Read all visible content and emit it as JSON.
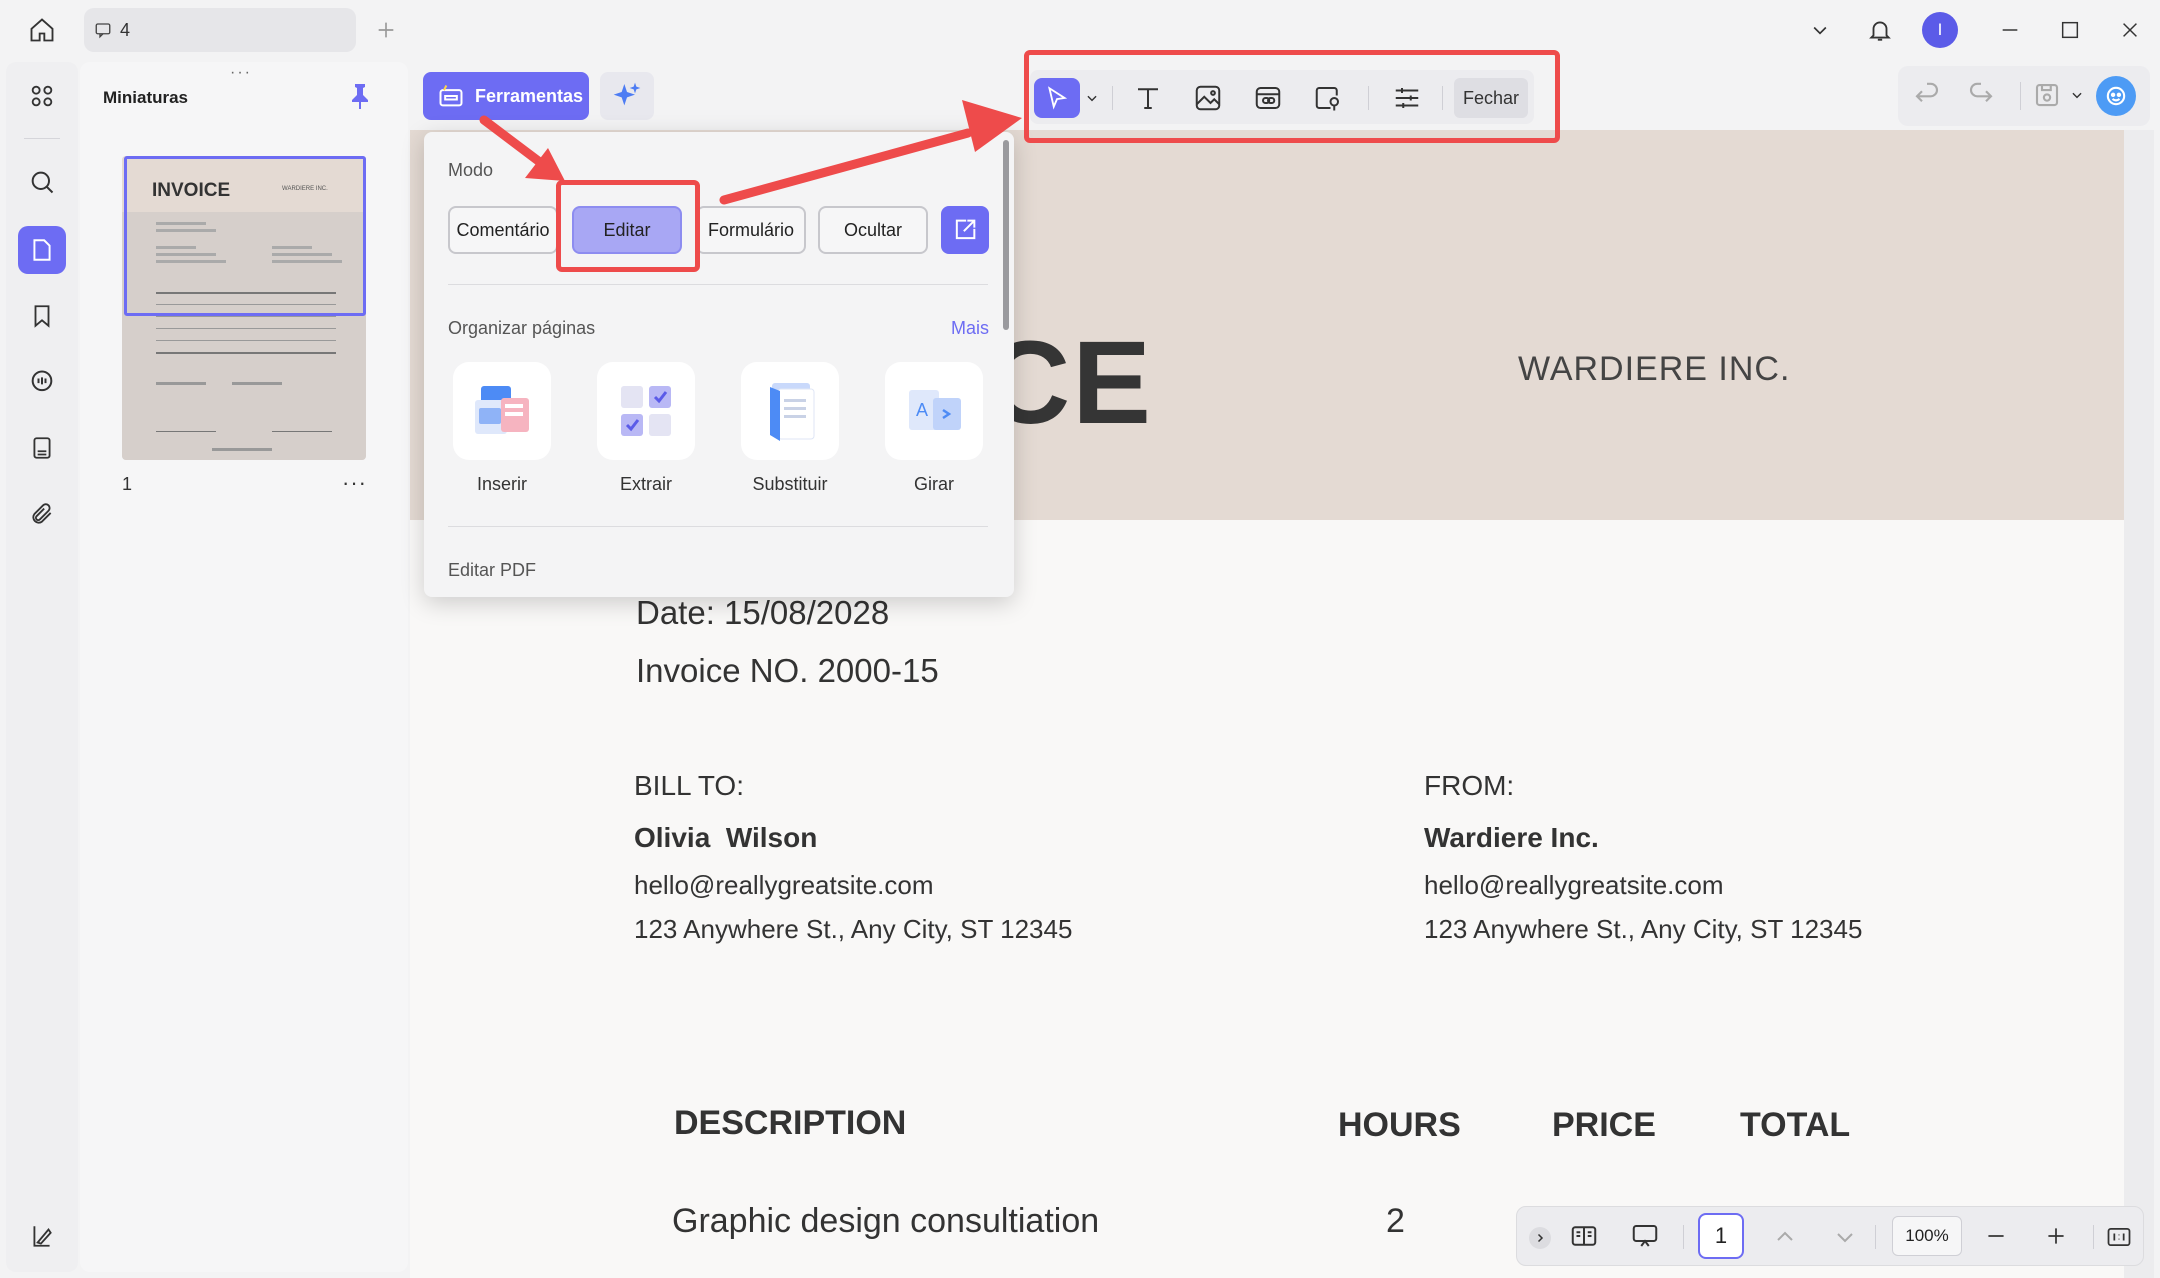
{
  "titlebar": {
    "tab_count": "4"
  },
  "avatar": {
    "initial": "I"
  },
  "thumbnails": {
    "title": "Miniaturas",
    "page_number": "1",
    "more": "···",
    "preview": {
      "title": "INVOICE",
      "company": "WARDIERE INC."
    }
  },
  "toolbar": {
    "tools_label": "Ferramentas",
    "close_label": "Fechar"
  },
  "panel": {
    "mode_heading": "Modo",
    "modes": [
      "Comentário",
      "Editar",
      "Formulário",
      "Ocultar"
    ],
    "organize_heading": "Organizar páginas",
    "more_link": "Mais",
    "organize_items": [
      "Inserir",
      "Extrair",
      "Substituir",
      "Girar"
    ],
    "edit_pdf_heading": "Editar PDF"
  },
  "document": {
    "title_fragment": "CE",
    "company": "WARDIERE INC.",
    "date": "Date: 15/08/2028",
    "invoice_no": "Invoice NO. 2000-15",
    "bill_to": {
      "label": "BILL TO:",
      "name": "Olivia  Wilson",
      "email": "hello@reallygreatsite.com",
      "address": "123 Anywhere St., Any City, ST 12345"
    },
    "from": {
      "label": "FROM:",
      "name": "Wardiere Inc.",
      "email": "hello@reallygreatsite.com",
      "address": "123 Anywhere St., Any City, ST 12345"
    },
    "table": {
      "headers": [
        "DESCRIPTION",
        "HOURS",
        "PRICE",
        "TOTAL"
      ],
      "rows": [
        [
          "Graphic design consultiation",
          "2",
          "",
          ""
        ]
      ]
    }
  },
  "statusbar": {
    "page": "1",
    "zoom": "100%"
  },
  "colors": {
    "accent": "#6d6cf3",
    "annotation": "#ee4b4b",
    "header_band": "#e4dad3"
  }
}
